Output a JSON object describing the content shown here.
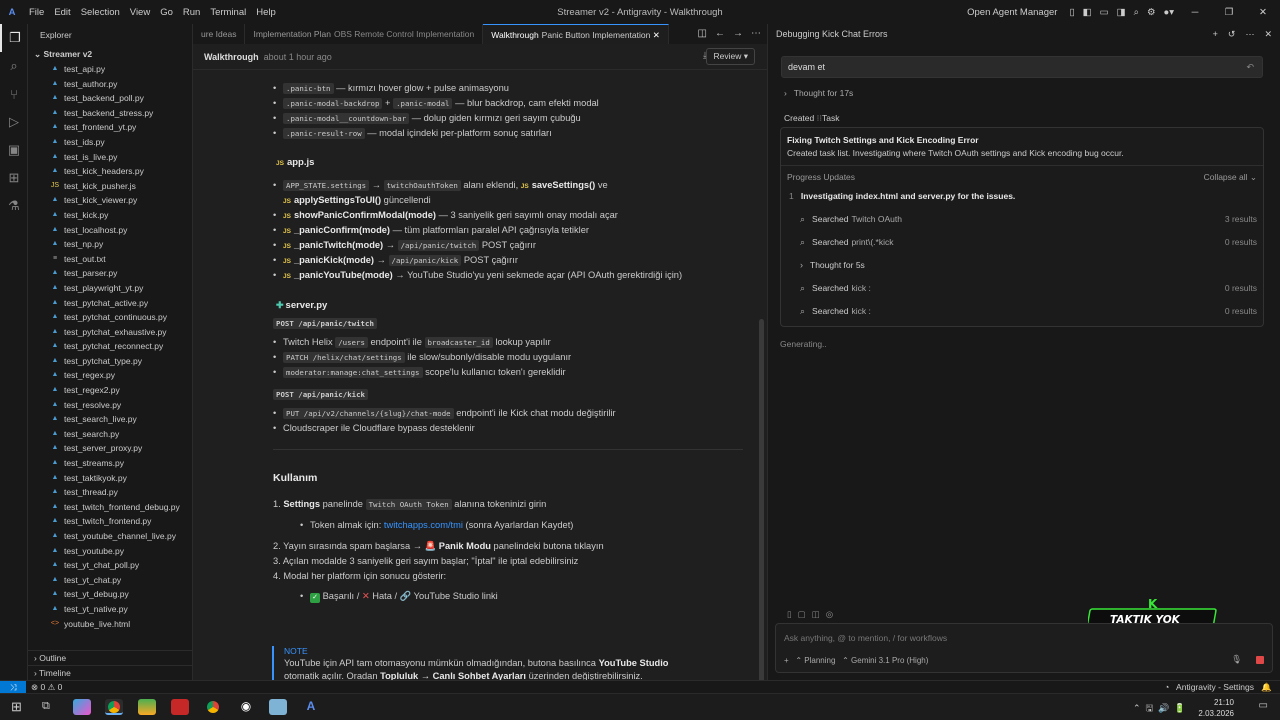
{
  "titlebar": {
    "menu": [
      "File",
      "Edit",
      "Selection",
      "View",
      "Go",
      "Run",
      "Terminal",
      "Help"
    ],
    "window_title": "Streamer v2 - Antigravity - Walkthrough",
    "open_agent_manager": "Open Agent Manager"
  },
  "explorer": {
    "header": "Explorer",
    "root": "Streamer v2",
    "files": [
      {
        "name": "test_api.py",
        "type": "py"
      },
      {
        "name": "test_author.py",
        "type": "py"
      },
      {
        "name": "test_backend_poll.py",
        "type": "py"
      },
      {
        "name": "test_backend_stress.py",
        "type": "py"
      },
      {
        "name": "test_frontend_yt.py",
        "type": "py"
      },
      {
        "name": "test_ids.py",
        "type": "py"
      },
      {
        "name": "test_is_live.py",
        "type": "py"
      },
      {
        "name": "test_kick_headers.py",
        "type": "py"
      },
      {
        "name": "test_kick_pusher.js",
        "type": "js"
      },
      {
        "name": "test_kick_viewer.py",
        "type": "py"
      },
      {
        "name": "test_kick.py",
        "type": "py"
      },
      {
        "name": "test_localhost.py",
        "type": "py"
      },
      {
        "name": "test_np.py",
        "type": "py"
      },
      {
        "name": "test_out.txt",
        "type": "txt"
      },
      {
        "name": "test_parser.py",
        "type": "py"
      },
      {
        "name": "test_playwright_yt.py",
        "type": "py"
      },
      {
        "name": "test_pytchat_active.py",
        "type": "py"
      },
      {
        "name": "test_pytchat_continuous.py",
        "type": "py"
      },
      {
        "name": "test_pytchat_exhaustive.py",
        "type": "py"
      },
      {
        "name": "test_pytchat_reconnect.py",
        "type": "py"
      },
      {
        "name": "test_pytchat_type.py",
        "type": "py"
      },
      {
        "name": "test_regex.py",
        "type": "py"
      },
      {
        "name": "test_regex2.py",
        "type": "py"
      },
      {
        "name": "test_resolve.py",
        "type": "py"
      },
      {
        "name": "test_search_live.py",
        "type": "py"
      },
      {
        "name": "test_search.py",
        "type": "py"
      },
      {
        "name": "test_server_proxy.py",
        "type": "py"
      },
      {
        "name": "test_streams.py",
        "type": "py"
      },
      {
        "name": "test_taktikyok.py",
        "type": "py"
      },
      {
        "name": "test_thread.py",
        "type": "py"
      },
      {
        "name": "test_twitch_frontend_debug.py",
        "type": "py"
      },
      {
        "name": "test_twitch_frontend.py",
        "type": "py"
      },
      {
        "name": "test_youtube_channel_live.py",
        "type": "py"
      },
      {
        "name": "test_youtube.py",
        "type": "py"
      },
      {
        "name": "test_yt_chat_poll.py",
        "type": "py"
      },
      {
        "name": "test_yt_chat.py",
        "type": "py"
      },
      {
        "name": "test_yt_debug.py",
        "type": "py"
      },
      {
        "name": "test_yt_native.py",
        "type": "py"
      },
      {
        "name": "youtube_live.html",
        "type": "html"
      }
    ],
    "outline": "Outline",
    "timeline": "Timeline"
  },
  "tabs": [
    {
      "label": "ure Ideas",
      "sub": ""
    },
    {
      "label": "Implementation Plan",
      "sub": "OBS Remote Control Implementation"
    },
    {
      "label": "Walkthrough",
      "sub": "Panic Button Implementation"
    }
  ],
  "walkthrough": {
    "name": "Walkthrough",
    "time": "about 1 hour ago",
    "review": "Review",
    "css_items": [
      {
        "code": ".panic-btn",
        "text": "— kırmızı hover glow + pulse animasyonu"
      },
      {
        "code": ".panic-modal-backdrop",
        "plus": "+",
        "code2": ".panic-modal",
        "text": "— blur backdrop, cam efekti modal"
      },
      {
        "code": ".panic-modal__countdown-bar",
        "text": "— dolup giden kırmızı geri sayım çubuğu"
      },
      {
        "code": ".panic-result-row",
        "text": "— modal içindeki per-platform sonuç satırları"
      }
    ],
    "appjs": {
      "title": "app.js",
      "l1_code1": "APP_STATE.settings",
      "arrow": "→",
      "l1_code2": "twitchOauthToken",
      "l1_text": "alanı eklendi,",
      "l1_fn": "saveSettings()",
      "l1_ve": "ve",
      "l1b_fn": "applySettingsToUI()",
      "l1b_text": "güncellendi",
      "items": [
        {
          "fn": "showPanicConfirmModal(mode)",
          "text": "— 3 saniyelik geri sayımlı onay modalı açar"
        },
        {
          "fn": "_panicConfirm(mode)",
          "text": "— tüm platformları paralel API çağrısıyla tetikler"
        },
        {
          "fn": "_panicTwitch(mode)",
          "code": "/api/panic/twitch",
          "text": "POST çağırır"
        },
        {
          "fn": "_panicKick(mode)",
          "code": "/api/panic/kick",
          "text": "POST çağırır"
        },
        {
          "fn": "_panicYouTube(mode)",
          "text": "→ YouTube Studio'yu yeni sekmede açar (API OAuth gerektirdiği için)"
        }
      ]
    },
    "serverpy": {
      "title": "server.py",
      "ep1": "POST /api/panic/twitch",
      "t1a": "Twitch Helix",
      "t1c1": "/users",
      "t1b": "endpoint'i ile",
      "t1c2": "broadcaster_id",
      "t1d": "lookup yapılır",
      "t2c": "PATCH /helix/chat/settings",
      "t2": "ile slow/subonly/disable modu uygulanır",
      "t3c": "moderator:manage:chat_settings",
      "t3": "scope'lu kullanıcı token'ı gereklidir",
      "ep2": "POST /api/panic/kick",
      "t4c": "PUT /api/v2/channels/{slug}/chat-mode",
      "t4": "endpoint'i ile Kick chat modu değiştirilir",
      "t5": "Cloudscraper ile Cloudflare bypass desteklenir"
    },
    "usage": {
      "title": "Kullanım",
      "s1n": "1.",
      "s1b": "Settings",
      "s1a": "panelinde",
      "s1c": "Twitch OAuth Token",
      "s1d": "alanına tokeninizi girin",
      "s1sub_a": "Token almak için:",
      "s1sub_link": "twitchapps.com/tmi",
      "s1sub_b": "(sonra Ayarlardan Kaydet)",
      "s2": "2. Yayın sırasında spam başlarsa →",
      "s2b": "Panik Modu",
      "s2c": "panelindeki butona tıklayın",
      "s3": "3. Açılan modalde 3 saniyelik geri sayım başlar; \"İptal\" ile iptal edebilirsiniz",
      "s4": "4. Modal her platform için sonucu gösterir:",
      "s4sub_a": "Başarılı /",
      "s4sub_b": "Hata /",
      "s4sub_c": "YouTube Studio linki"
    },
    "note": {
      "label": "NOTE",
      "l1a": "YouTube için API tam otomasyonu mümkün olmadığından, butona basılınca",
      "l1b": "YouTube Studio",
      "l2a": "otomatik açılır. Oradan",
      "l2b": "Topluluk → Canlı Sohbet Ayarları",
      "l2c": "üzerinden değiştirebilirsiniz."
    }
  },
  "chat": {
    "title": "Debugging Kick Chat Errors",
    "user_message": "devam et",
    "thought1": "Thought for 17s",
    "created": "Created",
    "task": "Task",
    "task_title": "Fixing Twitch Settings and Kick Encoding Error",
    "task_desc": "Created task list. Investigating where Twitch OAuth settings and Kick encoding bug occur.",
    "progress": "Progress Updates",
    "collapse": "Collapse all",
    "step_num": "1",
    "step": "Investigating index.html and server.py for the issues.",
    "searches": [
      {
        "label": "Searched",
        "query": "Twitch OAuth",
        "count": "3 results"
      },
      {
        "label": "Searched",
        "query": "print\\(.*kick",
        "count": "0 results"
      },
      {
        "label": "Thought for 5s",
        "query": "",
        "count": ""
      },
      {
        "label": "Searched",
        "query": "kick :",
        "count": "0 results"
      },
      {
        "label": "Searched",
        "query": "kick :",
        "count": "0 results"
      }
    ],
    "generating": "Generating..",
    "input_placeholder": "Ask anything, @ to mention, / for workflows",
    "mode": "Planning",
    "model": "Gemini 3.1 Pro (High)",
    "logo_text": "TAKTIK YOK",
    "logo_sub": "taktik yok",
    "logo_k": "K"
  },
  "status": {
    "errors": "0",
    "warnings": "0",
    "right": "Antigravity - Settings"
  },
  "taskbar": {
    "time": "21:10",
    "date": "2.03.2026"
  }
}
